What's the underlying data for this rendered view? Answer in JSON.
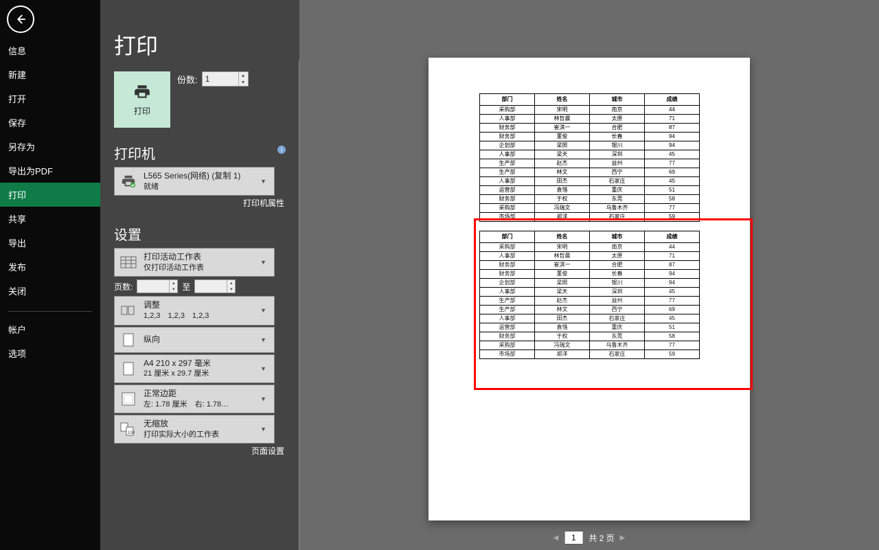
{
  "sidebar": {
    "items": [
      "信息",
      "新建",
      "打开",
      "保存",
      "另存为",
      "导出为PDF",
      "打印",
      "共享",
      "导出",
      "发布",
      "关闭"
    ],
    "items2": [
      "帐户",
      "选项"
    ]
  },
  "panel": {
    "title": "打印",
    "print_btn": "打印",
    "copies_label": "份数:",
    "copies_value": "1",
    "printer_title": "打印机",
    "printer_name": "L565 Series(网络) (复制 1)",
    "printer_status": "就绪",
    "printer_link": "打印机属性",
    "settings_title": "设置",
    "active_sheets_1": "打印活动工作表",
    "active_sheets_2": "仅打印活动工作表",
    "pages_label": "页数:",
    "to_label": "至",
    "collate_1": "调整",
    "collate_2": "1,2,3　1,2,3　1,2,3",
    "orientation": "纵向",
    "paper_1": "A4 210 x 297 毫米",
    "paper_2": "21 厘米 x 29.7 厘米",
    "margins_1": "正常边距",
    "margins_2": "左:  1.78 厘米　右:  1.78…",
    "scaling_1": "无缩放",
    "scaling_2": "打印实际大小的工作表",
    "page_setup_link": "页面设置"
  },
  "preview": {
    "table_headers": [
      "部门",
      "姓名",
      "城市",
      "成绩"
    ],
    "rows": [
      [
        "采购部",
        "宋明",
        "南京",
        "44"
      ],
      [
        "人事部",
        "林哲晨",
        "太原",
        "71"
      ],
      [
        "财务部",
        "崔淇一",
        "合肥",
        "87"
      ],
      [
        "财务部",
        "董俊",
        "长春",
        "94"
      ],
      [
        "企划部",
        "梁照",
        "银川",
        "94"
      ],
      [
        "人事部",
        "梁天",
        "深圳",
        "45"
      ],
      [
        "生产部",
        "赵杰",
        "益州",
        "77"
      ],
      [
        "生产部",
        "林文",
        "西宁",
        "69"
      ],
      [
        "人事部",
        "田杰",
        "石家庄",
        "45"
      ],
      [
        "运营部",
        "袁惜",
        "重庆",
        "51"
      ],
      [
        "财务部",
        "于权",
        "东莞",
        "58"
      ],
      [
        "采购部",
        "冯瑞文",
        "乌鲁木齐",
        "77"
      ],
      [
        "市场部",
        "郑洋",
        "石家庄",
        "59"
      ]
    ],
    "pager_current": "1",
    "pager_total": "共 2 页"
  }
}
